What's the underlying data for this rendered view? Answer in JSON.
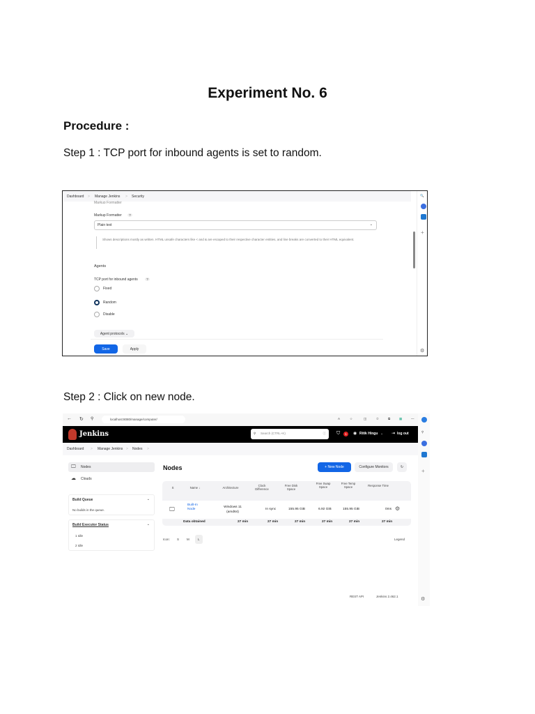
{
  "doc": {
    "title": "Experiment No. 6",
    "procedure": "Procedure :",
    "step1": "Step 1 : TCP port for inbound agents is set to random.",
    "step2": "Step 2 : Click on new node."
  },
  "shot1": {
    "breadcrumb": [
      "Dashboard",
      "Manage Jenkins",
      "Security"
    ],
    "section_cut": "Markup Formatter",
    "markup_label": "Markup Formatter",
    "help": "?",
    "markup_value": "Plain text",
    "markup_desc": "Shows descriptions mostly as written. HTML unsafe characters like < and & are escaped to their respective character entities, and line breaks are converted to their HTML equivalent.",
    "agents_heading": "Agents",
    "tcp_label": "TCP port for inbound agents",
    "options": [
      "Fixed",
      "Random",
      "Disable"
    ],
    "selected": "Random",
    "agent_protocols": "Agent protocols",
    "save": "Save",
    "apply": "Apply"
  },
  "shot2": {
    "url": "localhost:8080/manage/computer/",
    "brand": "Jenkins",
    "search_placeholder": "Search (CTRL+K)",
    "alert_count": "1",
    "user": "Ritik Hingu",
    "logout": "log out",
    "breadcrumb": [
      "Dashboard",
      "Manage Jenkins",
      "Nodes"
    ],
    "side": {
      "nodes": "Nodes",
      "clouds": "Clouds",
      "build_queue": "Build Queue",
      "queue_empty": "No builds in the queue.",
      "executor_status": "Build Executor Status",
      "executors": [
        "1  Idle",
        "2  Idle"
      ]
    },
    "page_title": "Nodes",
    "new_node": "+ New Node",
    "configure_monitors": "Configure Monitors",
    "table": {
      "headers": [
        "S",
        "Name ↓",
        "Architecture",
        "Clock Difference",
        "Free Disk Space",
        "Free Swap Space",
        "Free Temp Space",
        "Response Time"
      ],
      "row": {
        "name": "Built-In Node",
        "arch": "Windows 11 (amd64)",
        "clock": "In sync",
        "disk": "155.95 GiB",
        "swap": "6.92 GiB",
        "temp": "155.95 GiB",
        "resp": "0ms"
      },
      "footer": {
        "label": "Data obtained",
        "values": [
          "27 min",
          "27 min",
          "27 min",
          "27 min",
          "27 min",
          "27 min"
        ]
      }
    },
    "icon_label": "Icon:",
    "sizes": [
      "S",
      "M",
      "L"
    ],
    "legend": "Legend",
    "rest_api": "REST API",
    "version": "Jenkins 2.462.1"
  }
}
